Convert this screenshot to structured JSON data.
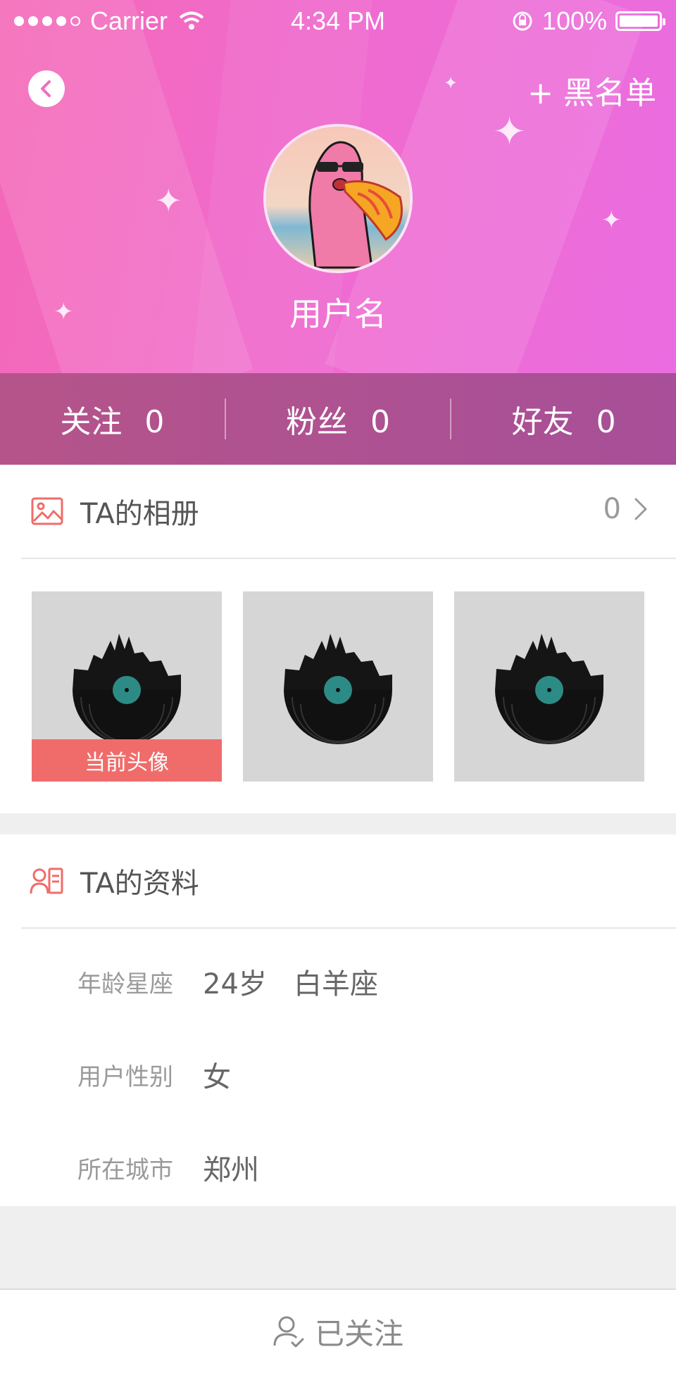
{
  "status_bar": {
    "carrier": "Carrier",
    "time": "4:34 PM",
    "battery": "100%"
  },
  "header": {
    "back_icon": "chevron-left-icon",
    "blacklist_label": "+ 黑名单",
    "username": "用户名",
    "gradient_colors": [
      "#f468b6",
      "#ea6ce0"
    ]
  },
  "stats": [
    {
      "label": "关注",
      "value": "0"
    },
    {
      "label": "粉丝",
      "value": "0"
    },
    {
      "label": "好友",
      "value": "0"
    }
  ],
  "album": {
    "title": "TA的相册",
    "count": "0",
    "icon": "picture-icon",
    "photos": [
      {
        "badge": "当前头像"
      },
      {
        "badge": ""
      },
      {
        "badge": ""
      }
    ]
  },
  "profile": {
    "title": "TA的资料",
    "icon": "profile-card-icon",
    "rows": [
      {
        "label": "年龄星座",
        "value": "24岁   白羊座"
      },
      {
        "label": "用户性别",
        "value": "女"
      },
      {
        "label": "所在城市",
        "value": "郑州"
      }
    ]
  },
  "footer": {
    "followed_label": "已关注",
    "icon": "user-check-icon"
  },
  "colors": {
    "accent": "#f06c6a",
    "stats_bar": "#aa4f94"
  }
}
